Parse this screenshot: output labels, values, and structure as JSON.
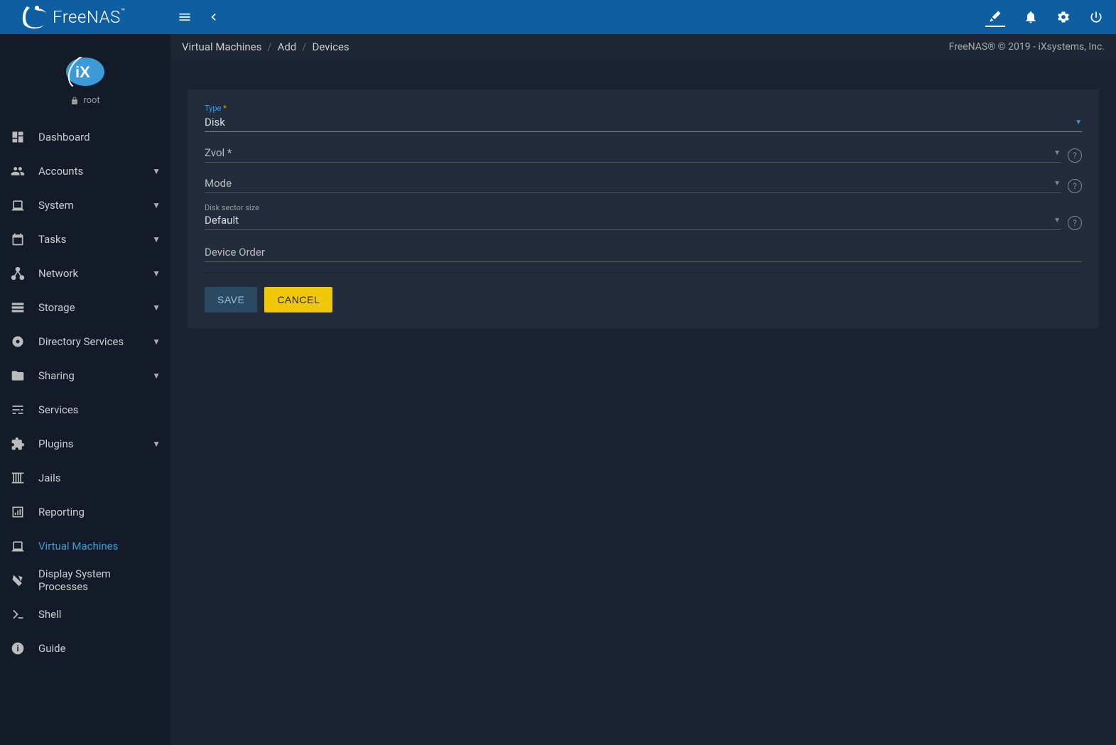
{
  "header": {
    "brand": "FreeNAS",
    "user": "root"
  },
  "breadcrumb": {
    "items": [
      "Virtual Machines",
      "Add",
      "Devices"
    ],
    "copyright": "FreeNAS® © 2019 - iXsystems, Inc."
  },
  "sidebar": {
    "items": [
      {
        "label": "Dashboard",
        "icon": "dashboard",
        "expandable": false
      },
      {
        "label": "Accounts",
        "icon": "people",
        "expandable": true
      },
      {
        "label": "System",
        "icon": "laptop",
        "expandable": true
      },
      {
        "label": "Tasks",
        "icon": "calendar",
        "expandable": true
      },
      {
        "label": "Network",
        "icon": "share",
        "expandable": true
      },
      {
        "label": "Storage",
        "icon": "storage",
        "expandable": true
      },
      {
        "label": "Directory Services",
        "icon": "target",
        "expandable": true
      },
      {
        "label": "Sharing",
        "icon": "folder",
        "expandable": true
      },
      {
        "label": "Services",
        "icon": "tune",
        "expandable": false
      },
      {
        "label": "Plugins",
        "icon": "extension",
        "expandable": true
      },
      {
        "label": "Jails",
        "icon": "jail",
        "expandable": false
      },
      {
        "label": "Reporting",
        "icon": "chart",
        "expandable": false
      },
      {
        "label": "Virtual Machines",
        "icon": "laptop",
        "expandable": false,
        "active": true
      },
      {
        "label": "Display System Processes",
        "icon": "process",
        "expandable": false
      },
      {
        "label": "Shell",
        "icon": "terminal",
        "expandable": false
      },
      {
        "label": "Guide",
        "icon": "info",
        "expandable": false
      }
    ]
  },
  "form": {
    "type": {
      "label": "Type",
      "value": "Disk",
      "required": true
    },
    "zvol": {
      "label": "Zvol *",
      "value": ""
    },
    "mode": {
      "label": "Mode",
      "value": ""
    },
    "sector": {
      "label": "Disk sector size",
      "value": "Default"
    },
    "order": {
      "label": "Device Order",
      "value": ""
    },
    "save": "SAVE",
    "cancel": "CANCEL"
  }
}
